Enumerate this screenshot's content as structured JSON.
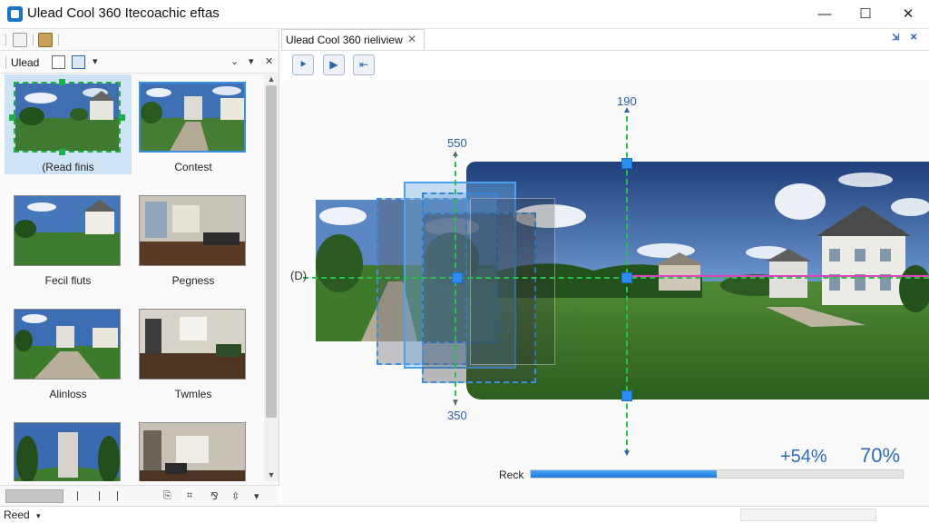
{
  "app": {
    "title": "Ulead Cool 360 Itecoachic eftas",
    "window_controls": [
      "—",
      "☐",
      "✕"
    ]
  },
  "left_toolbar": {
    "icons": [
      "document-icon",
      "package-icon"
    ]
  },
  "library_panel": {
    "title": "Ulead",
    "controls": [
      "▾",
      "⌄",
      "✕"
    ]
  },
  "thumbnails": [
    {
      "label": "(Read finis",
      "scene": "lawn-house",
      "selected": true
    },
    {
      "label": "Contest",
      "scene": "path-building",
      "highlighted": true
    },
    {
      "label": "Fecil fluts",
      "scene": "house-lawn"
    },
    {
      "label": "Pegness",
      "scene": "interior"
    },
    {
      "label": "Alinloss",
      "scene": "courtyard"
    },
    {
      "label": "Twmles",
      "scene": "interior-dark"
    },
    {
      "label": "",
      "scene": "fisheye-tower"
    },
    {
      "label": "",
      "scene": "hallway"
    }
  ],
  "left_bottom": {
    "ticks": [
      "|",
      "|",
      "|"
    ],
    "right_icons": [
      "⎘",
      "⌗",
      "⅋",
      "⇳",
      "▾"
    ]
  },
  "status_bar": {
    "label": "Reed",
    "arrow": "▾"
  },
  "document_tab": {
    "label": "Ulead Cool 360 rieliview",
    "close": "✕"
  },
  "preview_toolbar": {
    "buttons": [
      {
        "name": "step-button",
        "glyph": "⯈"
      },
      {
        "name": "play-button",
        "glyph": "▶"
      },
      {
        "name": "back-button",
        "glyph": "⇤"
      }
    ]
  },
  "canvas": {
    "coord_top": "190",
    "coord_upper": "550",
    "coord_lower": "350",
    "coord_left": "(D)"
  },
  "stats": {
    "change": "+54%",
    "total": "70%"
  },
  "progress": {
    "label": "Reck",
    "value": 0.5
  },
  "colors": {
    "accent": "#2a8ff0",
    "guide_green": "#27c24c",
    "guide_magenta": "#e040c0",
    "overlay_blue": "#4aa3f0"
  }
}
